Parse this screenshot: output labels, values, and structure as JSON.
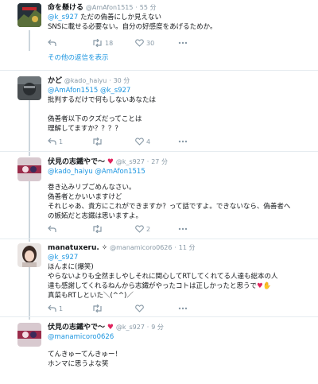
{
  "tweets": [
    {
      "name": "命を懸ける",
      "handle": "@AmAfon1515",
      "time": "55 分",
      "mention": "@k_s927",
      "text1": " ただの偽善にしか見えない",
      "text2": "SNSに載せる必要ない。自分の好感度をあげるためか。",
      "reply_count": "",
      "retweet_count": "18",
      "like_count": "30"
    },
    {
      "name": "かど",
      "handle": "@kado_haiyu",
      "time": "30 分",
      "mentions": "@AmAfon1515 @k_s927",
      "lines": [
        "批判するだけで何もしないあなたは",
        "",
        "偽善者以下のクズだってことは",
        "理解してますか？？？？"
      ],
      "reply_count": "1",
      "retweet_count": "",
      "like_count": "4"
    },
    {
      "name": "伏見の志鐵やで〜",
      "handle": "@k_s927",
      "time": "27 分",
      "mentions": "@kado_haiyu @AmAfon1515",
      "lines": [
        "巻き込みリプごめんなさい。",
        "偽善者とかいいますけど",
        "それじゃあ、貴方にこれができますか？って話ですよ。できないなら、偽善者へ",
        "の嫉妬だと志鐵は思いますよ。"
      ],
      "reply_count": "",
      "retweet_count": "",
      "like_count": "2"
    },
    {
      "name": "manatuxeru.",
      "handle": "@manamicoro0626",
      "time": "11 分",
      "mention": "@k_s927",
      "lines": [
        "ほんまに(爆笑)",
        "やらないよりも全然ましやしそれに関心してRTしてくれてる人達も総本の人",
        "達も感謝してくれるねんから志鐵がやったコトは正しかったと思うで",
        "真菜もRTしといた＼(^^)／"
      ],
      "reply_count": "1",
      "retweet_count": "",
      "like_count": ""
    },
    {
      "name": "伏見の志鐵やで〜",
      "handle": "@k_s927",
      "time": "9 分",
      "mention": "@manamicoro0626",
      "lines": [
        "てんきゅーてんきゅー！",
        "ホンマに思うよな笑"
      ]
    }
  ],
  "show_replies_label": "その他の返信を表示",
  "colors": {
    "accent": "#1b95e0",
    "muted": "#8899a6",
    "like": "#e0245e"
  }
}
